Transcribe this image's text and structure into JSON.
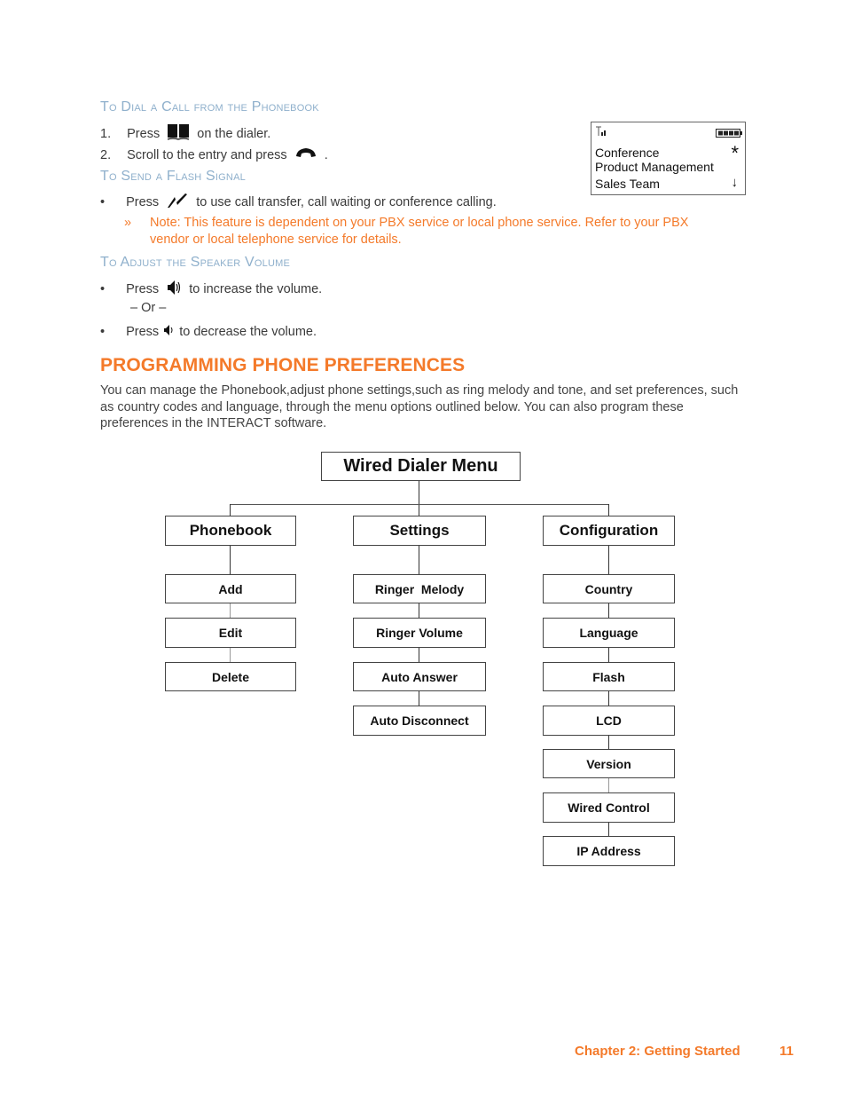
{
  "dial_section": {
    "heading": "To Dial a Call from the Phonebook",
    "steps": [
      {
        "num": "1.",
        "before": "Press",
        "icon": "phonebook-icon",
        "after": "on the dialer."
      },
      {
        "num": "2.",
        "before": "Scroll to the entry and press",
        "icon": "handset-call-icon",
        "after": "."
      }
    ]
  },
  "flash_section": {
    "heading": "To Send a Flash Signal",
    "bullet": {
      "before": "Press",
      "icon": "flash-icon",
      "after": "to use call transfer, call waiting or conference calling."
    },
    "note_marker": "»",
    "note": "Note: This feature is dependent on your PBX service or local phone service. Refer to your PBX vendor or local telephone service for details."
  },
  "volume_section": {
    "heading": "To Adjust the Speaker Volume",
    "increase": {
      "before": "Press",
      "icon": "volume-up-icon",
      "after": "to increase the volume."
    },
    "or": "– Or –",
    "decrease": {
      "before": "Press",
      "icon": "volume-down-icon",
      "after": "to decrease the volume."
    }
  },
  "lcd_display": {
    "signal_icon": "signal-antenna-icon",
    "battery_icon": "battery-full-icon",
    "rows": [
      "Conference",
      "Product Management",
      "Sales Team"
    ],
    "star": "*",
    "arrow": "↓"
  },
  "section": {
    "title": "PROGRAMMING PHONE PREFERENCES",
    "paragraph": "You can manage the Phonebook,adjust phone settings,such as ring melody and tone, and set preferences, such as country codes and language, through the menu options outlined below. You can also program these preferences in the INTERACT software."
  },
  "diagram": {
    "root": "Wired Dialer Menu",
    "branches": [
      {
        "label": "Phonebook",
        "items": [
          "Add",
          "Edit",
          "Delete"
        ]
      },
      {
        "label": "Settings",
        "items": [
          "Ringer  Melody",
          "Ringer Volume",
          "Auto Answer",
          "Auto Disconnect"
        ]
      },
      {
        "label": "Configuration",
        "items": [
          "Country",
          "Language",
          "Flash",
          "LCD",
          "Version",
          "Wired Control",
          "IP Address"
        ]
      }
    ]
  },
  "footer": {
    "chapter": "Chapter 2: Getting Started",
    "page": "11"
  },
  "colors": {
    "accent_orange": "#f47a2a",
    "subheading_blue": "#8fb0cc"
  }
}
